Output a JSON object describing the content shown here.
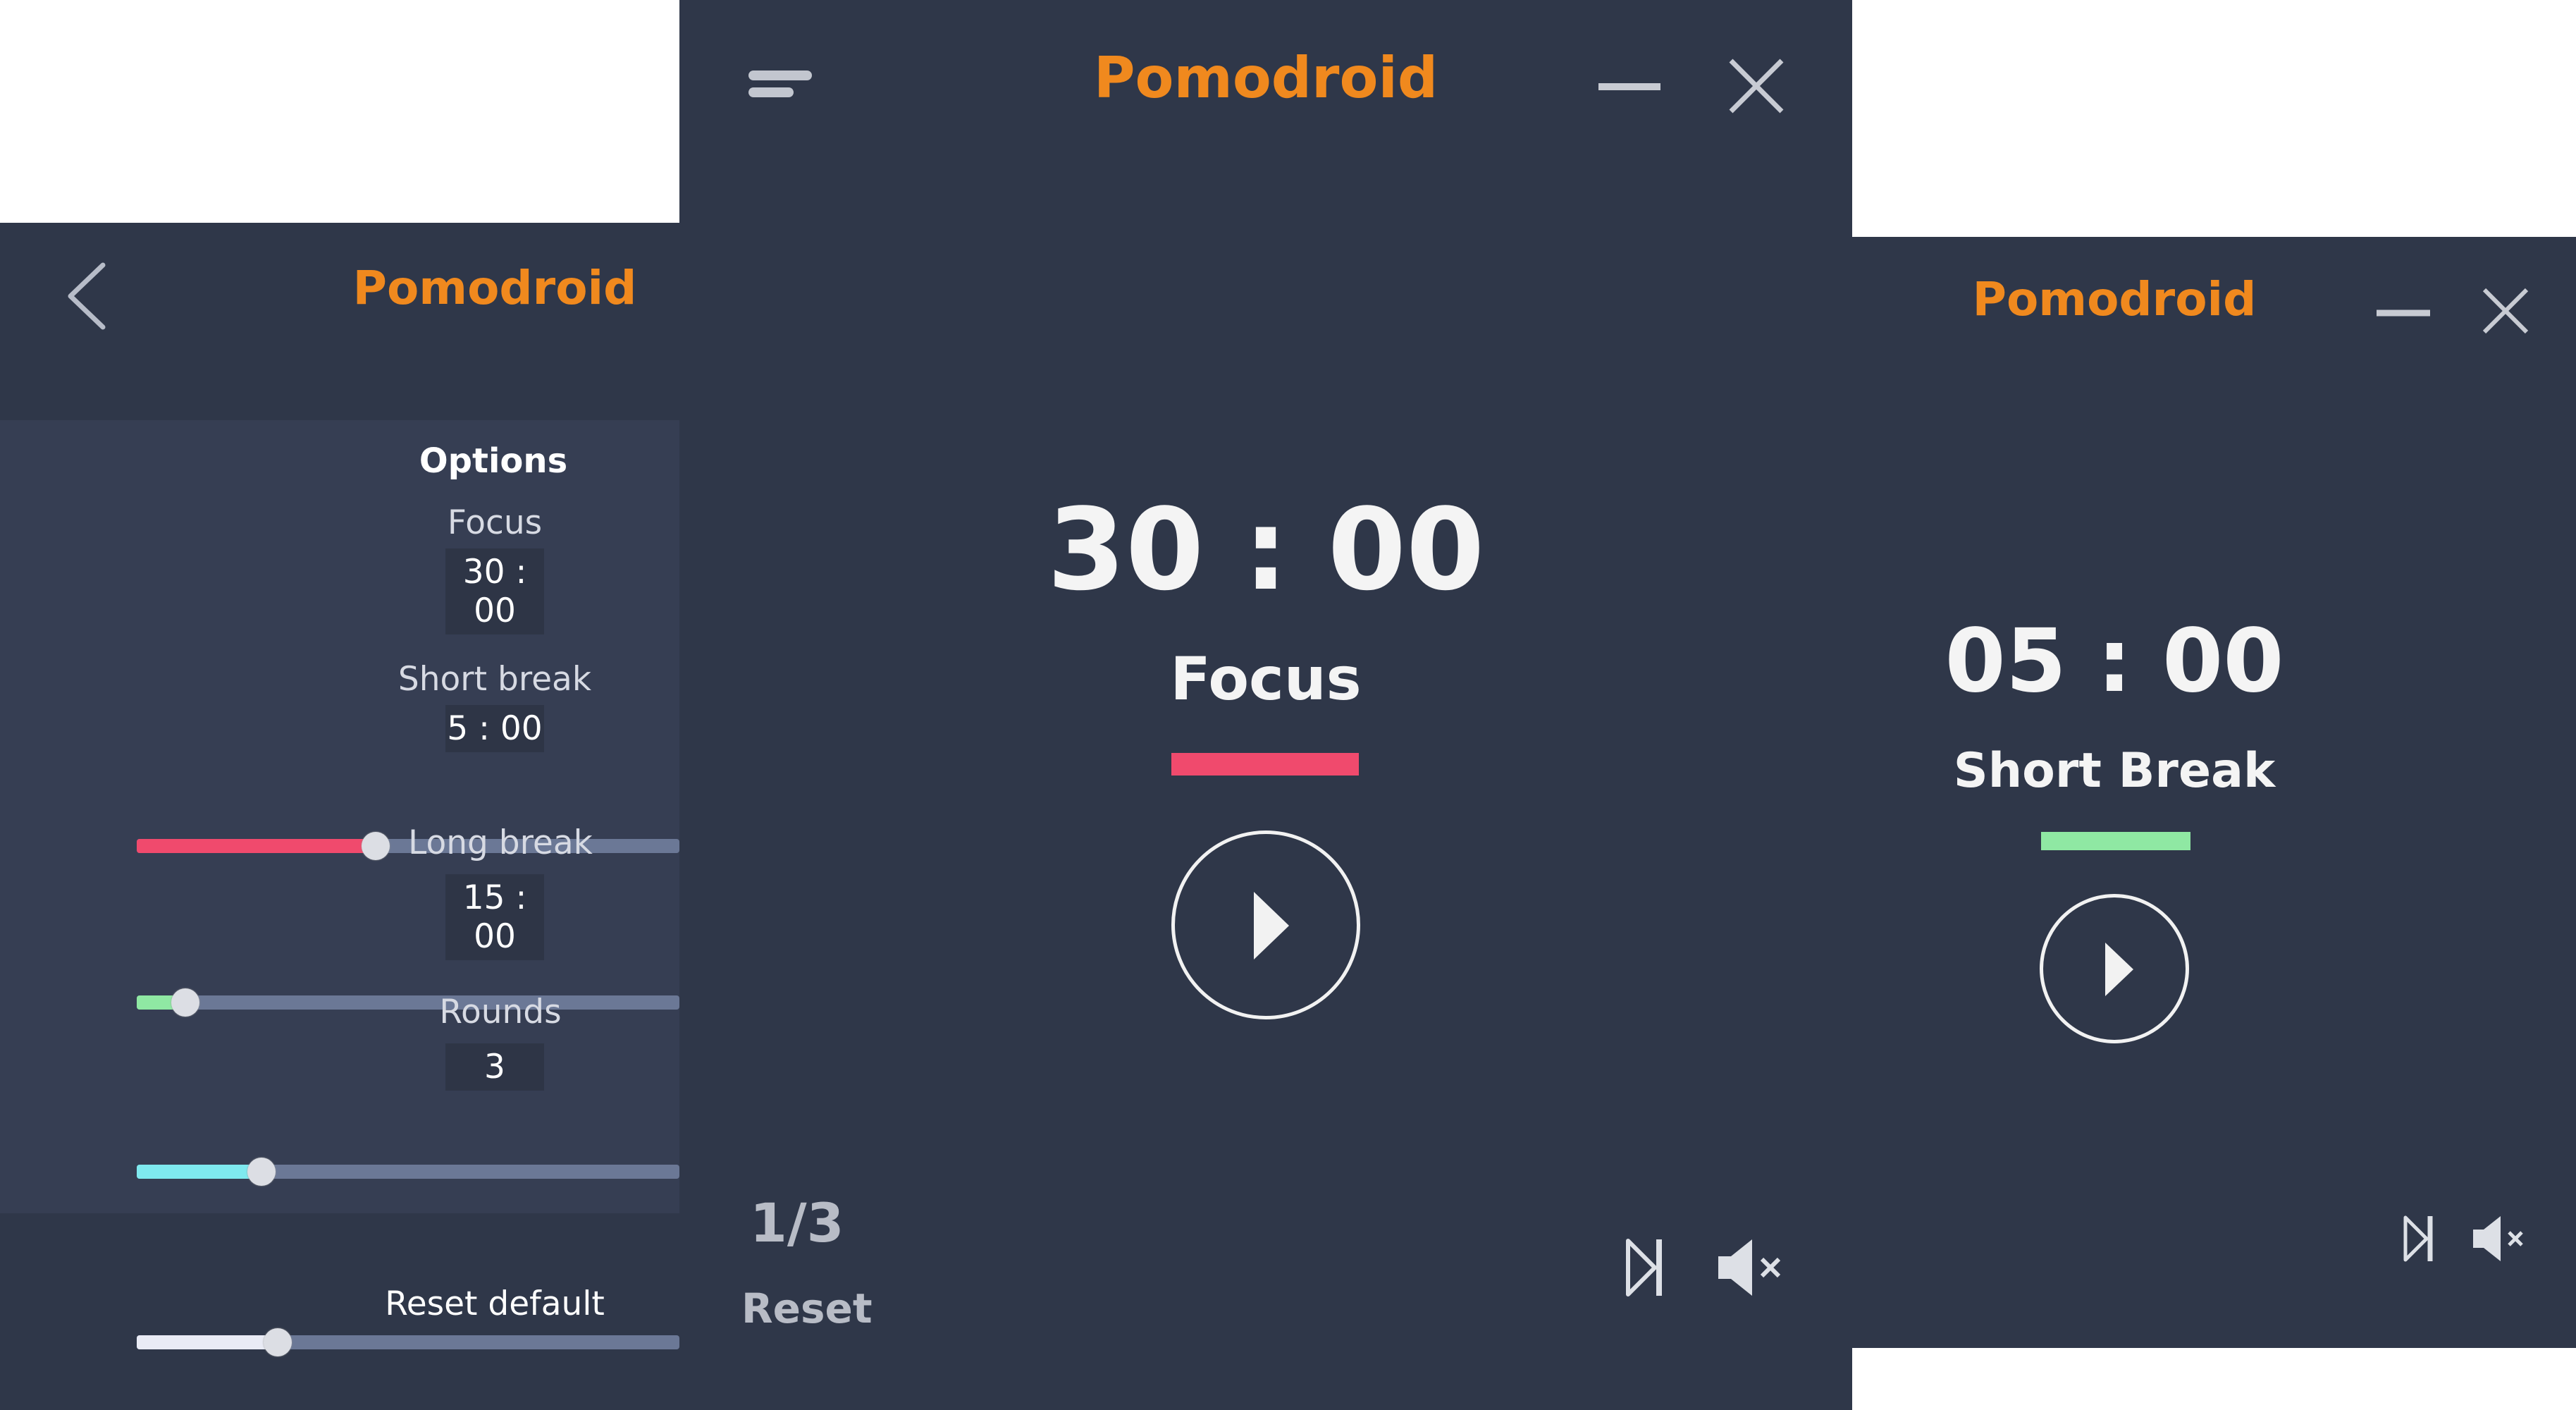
{
  "options_window": {
    "title": "Pomodroid",
    "back_icon": "chevron-left-icon",
    "section_title": "Options",
    "focus": {
      "label": "Focus",
      "value": "30 : 00",
      "level": 0.44,
      "color": "#f04a6d"
    },
    "short_break": {
      "label": "Short break",
      "value": "5 : 00",
      "level": 0.09,
      "color": "#8fe8a3"
    },
    "long_break": {
      "label": "Long break",
      "value": "15 : 00",
      "level": 0.23,
      "color": "#7fe9ef"
    },
    "rounds": {
      "label": "Rounds",
      "value": "3",
      "level": 0.26,
      "color": "#e9ebf5"
    },
    "reset_label": "Reset default"
  },
  "main_window": {
    "title": "Pomodroid",
    "menu_icon": "menu-icon",
    "minimize_icon": "minimize-icon",
    "close_icon": "close-icon",
    "timer": "30 : 00",
    "mode": "Focus",
    "mode_color": "#f04a6d",
    "play_icon": "play-icon",
    "round_counter": "1/3",
    "reset_label": "Reset",
    "skip_icon": "skip-icon",
    "mute_icon": "mute-icon"
  },
  "short_window": {
    "title": "Pomodroid",
    "minimize_icon": "minimize-icon",
    "close_icon": "close-icon",
    "timer": "05 : 00",
    "mode": "Short Break",
    "mode_color": "#8fe8a3",
    "play_icon": "play-icon",
    "skip_icon": "skip-icon",
    "mute_icon": "mute-icon"
  }
}
